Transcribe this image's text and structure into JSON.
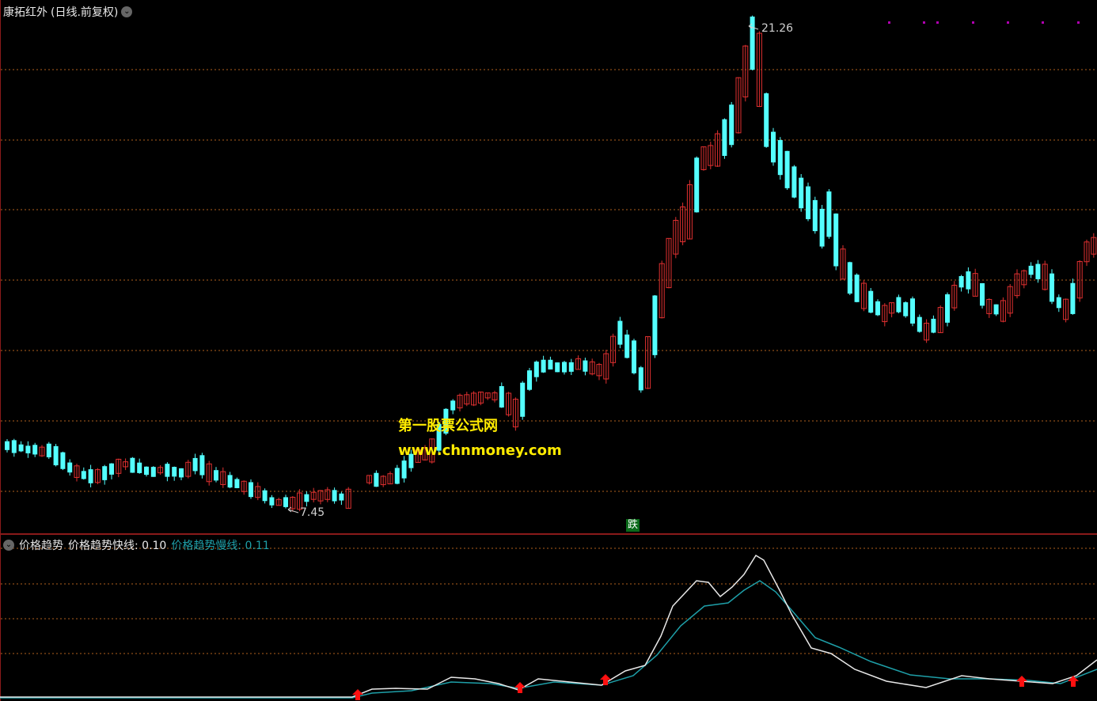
{
  "title": "康拓红外",
  "period": "(日线.前复权)",
  "main_chart": {
    "high_label": "21.26",
    "low_label": "7.45",
    "watermark_line1": "第一股票公式网",
    "watermark_line2": "www.chnmoney.com",
    "signal_badge": "跌",
    "colors": {
      "up": "#e03030",
      "down": "#54ffff",
      "grid": "#b0601e",
      "background": "#000000"
    }
  },
  "indicator": {
    "name": "价格趋势",
    "fast_label": "价格趋势快线:",
    "fast_value": "0.10",
    "slow_label": "价格趋势慢线:",
    "slow_value": "0.11",
    "colors": {
      "fast": "#e8e8e8",
      "slow": "#1e9fa8",
      "arrow": "#ff1010"
    }
  }
}
